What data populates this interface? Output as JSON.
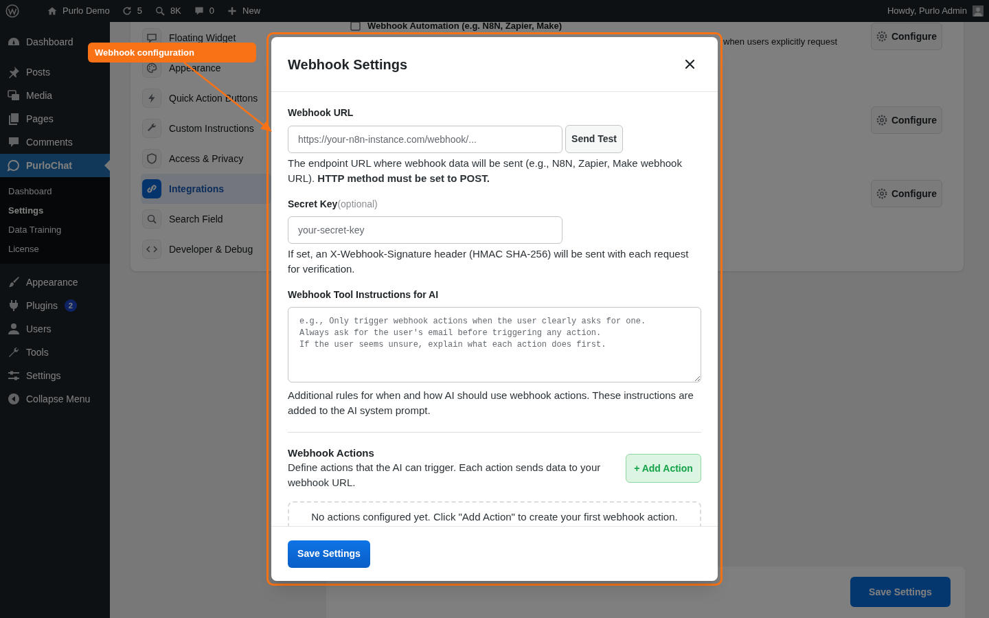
{
  "admin_bar": {
    "site_name": "Purlo Demo",
    "updates": "5",
    "stat": "8K",
    "comments": "0",
    "new_label": "New",
    "greeting": "Howdy, Purlo Admin"
  },
  "sidebar": {
    "groups": [
      {
        "items": [
          {
            "label": "Dashboard",
            "selected": false
          }
        ]
      },
      {
        "items": [
          {
            "label": "Posts",
            "selected": false
          },
          {
            "label": "Media",
            "selected": false
          },
          {
            "label": "Pages",
            "selected": false
          },
          {
            "label": "Comments",
            "selected": false
          },
          {
            "label": "PurloChat",
            "selected": true,
            "children": [
              {
                "label": "Dashboard",
                "selected": false
              },
              {
                "label": "Settings",
                "selected": true
              },
              {
                "label": "Data Training",
                "selected": false
              },
              {
                "label": "License",
                "selected": false
              }
            ]
          }
        ]
      },
      {
        "items": [
          {
            "label": "Appearance",
            "selected": false
          },
          {
            "label": "Plugins",
            "selected": false,
            "badge": "2"
          },
          {
            "label": "Users",
            "selected": false
          },
          {
            "label": "Tools",
            "selected": false
          },
          {
            "label": "Settings",
            "selected": false
          }
        ]
      }
    ],
    "collapse": "Collapse Menu"
  },
  "settings_nav": {
    "items": [
      {
        "label": "Floating Widget",
        "selected": false
      },
      {
        "label": "Appearance",
        "selected": false
      },
      {
        "label": "Quick Action Buttons",
        "selected": false
      },
      {
        "label": "Custom Instructions",
        "selected": false
      },
      {
        "label": "Access & Privacy",
        "selected": false
      },
      {
        "label": "Integrations",
        "selected": true
      },
      {
        "label": "Search Field",
        "selected": false
      },
      {
        "label": "Developer & Debug",
        "selected": false
      }
    ]
  },
  "integrations": [
    {
      "title": "Webhook Automation (e.g. N8N, Zapier, Make)",
      "description": "when users explicitly request",
      "button": "Configure"
    },
    {
      "button": "Configure"
    },
    {
      "button": "Configure"
    }
  ],
  "page_footer": {
    "save_button": "Save Settings"
  },
  "annotation": {
    "label": "Webhook configuration"
  },
  "modal": {
    "title": "Webhook Settings",
    "fields": [
      {
        "kind": "url",
        "label": "Webhook URL",
        "placeholder": "https://your-n8n-instance.com/webhook/...",
        "button": "Send Test",
        "help": "The endpoint URL where webhook data will be sent (e.g., N8N, Zapier, Make webhook URL). **HTTP method must be set to POST.**"
      },
      {
        "kind": "text",
        "label": "Secret Key",
        "label_note": "(optional)",
        "placeholder": "your-secret-key",
        "help": "If set, an X-Webhook-Signature header (HMAC SHA-256) will be sent with each request for verification."
      },
      {
        "kind": "textarea",
        "label": "Webhook Tool Instructions for AI",
        "placeholder": "e.g., Only trigger webhook actions when the user clearly asks for one.\nAlways ask for the user's email before triggering any action.\nIf the user seems unsure, explain what each action does first.",
        "help": "Additional rules for when and how AI should use webhook actions. These instructions are added to the AI system prompt."
      }
    ],
    "actions": {
      "title": "Webhook Actions",
      "description": "Define actions that the AI can trigger. Each action sends data to your webhook URL.",
      "add_button": "+ Add Action",
      "empty_message": "No actions configured yet. Click \"Add Action\" to create your first webhook action."
    },
    "save_button": "Save Settings"
  }
}
